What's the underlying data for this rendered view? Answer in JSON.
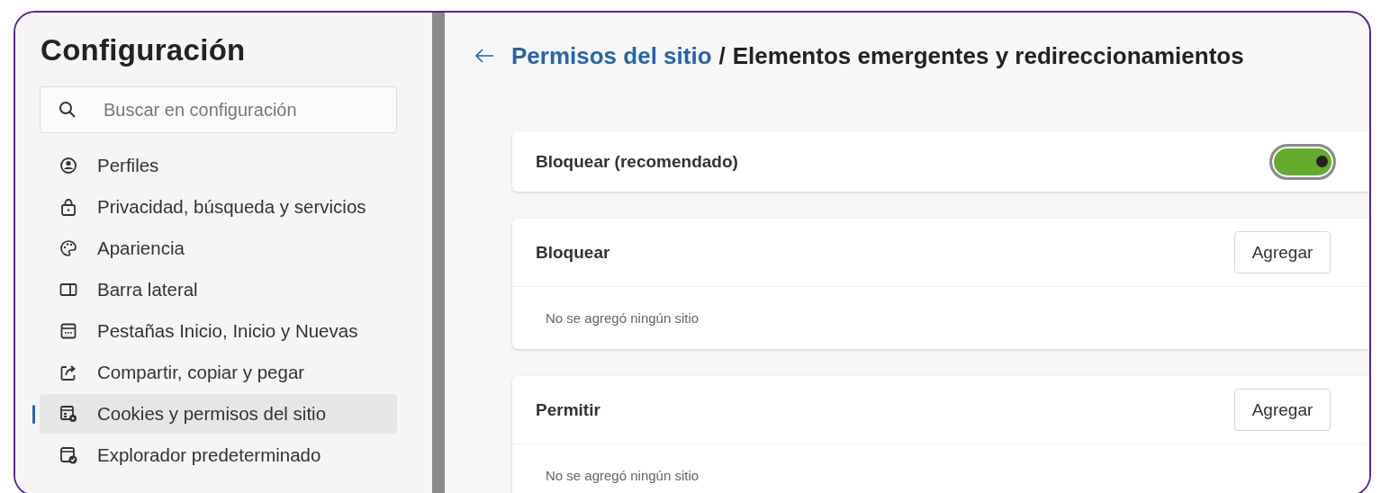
{
  "sidebar": {
    "title": "Configuración",
    "search": {
      "placeholder": "Buscar en configuración"
    },
    "items": [
      {
        "label": "Perfiles",
        "kind": "profile",
        "selected": false
      },
      {
        "label": "Privacidad, búsqueda y servicios",
        "kind": "lock",
        "selected": false
      },
      {
        "label": "Apariencia",
        "kind": "palette",
        "selected": false
      },
      {
        "label": "Barra lateral",
        "kind": "sidebar",
        "selected": false
      },
      {
        "label": "Pestañas Inicio, Inicio y Nuevas",
        "kind": "tabs",
        "selected": false
      },
      {
        "label": "Compartir, copiar y pegar",
        "kind": "share",
        "selected": false
      },
      {
        "label": "Cookies y permisos del sitio",
        "kind": "cookies",
        "selected": true
      },
      {
        "label": "Explorador predeterminado",
        "kind": "browser",
        "selected": false
      }
    ]
  },
  "main": {
    "breadcrumb": {
      "link": "Permisos del sitio",
      "separator": "/",
      "current": "Elementos emergentes y redireccionamientos"
    },
    "toggle_card": {
      "label": "Bloquear (recomendado)",
      "on": true
    },
    "lists": [
      {
        "title": "Bloquear",
        "button": "Agregar",
        "empty_text": "No se agregó ningún sitio"
      },
      {
        "title": "Permitir",
        "button": "Agregar",
        "empty_text": "No se agregó ningún sitio"
      }
    ]
  }
}
